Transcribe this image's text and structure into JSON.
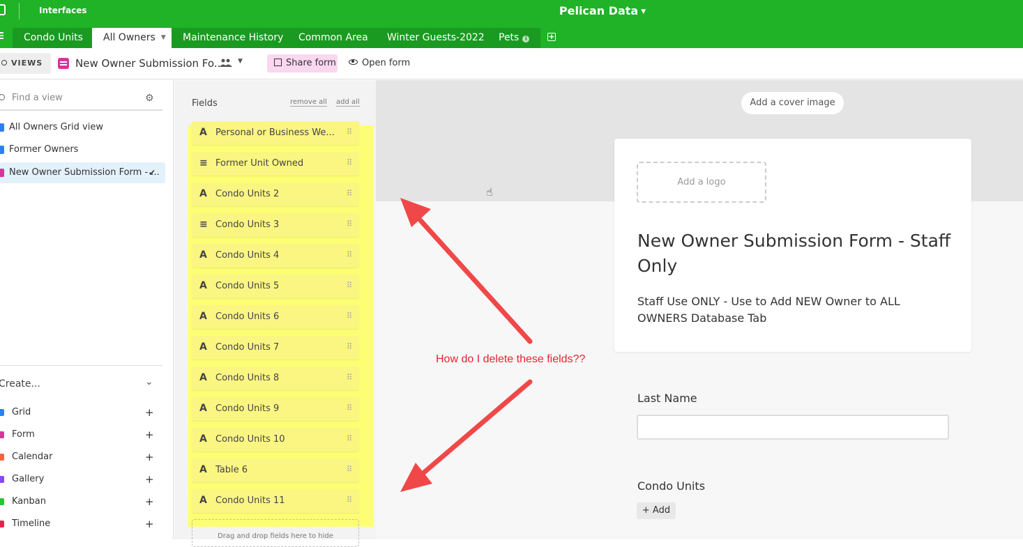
{
  "topbar": {
    "interfaces_label": "Interfaces",
    "base_title": "Pelican Data",
    "tabs": [
      "Condo Units",
      "All Owners",
      "Maintenance History",
      "Common Area",
      "Winter Guests-2022",
      "Pets"
    ],
    "active_tab": "All Owners"
  },
  "toolbar": {
    "views_label": "VIEWS",
    "view_name": "New Owner Submission Fo...",
    "share_label": "Share form",
    "open_label": "Open form"
  },
  "sidebar": {
    "find_placeholder": "Find a view",
    "views": [
      {
        "label": "All Owners Grid view",
        "color": "#2d7ff9"
      },
      {
        "label": "Former Owners",
        "color": "#2d7ff9"
      },
      {
        "label": "New Owner Submission Form - ...",
        "color": "#d6359c"
      }
    ],
    "create_label": "Create...",
    "create_items": [
      {
        "label": "Grid",
        "color": "#2d7ff9"
      },
      {
        "label": "Form",
        "color": "#d6359c"
      },
      {
        "label": "Calendar",
        "color": "#f7653b"
      },
      {
        "label": "Gallery",
        "color": "#8b46ff"
      },
      {
        "label": "Kanban",
        "color": "#20c933"
      },
      {
        "label": "Timeline",
        "color": "#e8234a"
      }
    ]
  },
  "fields_panel": {
    "title": "Fields",
    "remove_all": "remove all",
    "add_all": "add all",
    "fields": [
      {
        "type": "A",
        "name": "Personal or Business We..."
      },
      {
        "type": "≡",
        "name": "Former Unit Owned"
      },
      {
        "type": "A",
        "name": "Condo Units 2"
      },
      {
        "type": "≡",
        "name": "Condo Units 3"
      },
      {
        "type": "A",
        "name": "Condo Units 4"
      },
      {
        "type": "A",
        "name": "Condo Units 5"
      },
      {
        "type": "A",
        "name": "Condo Units 6"
      },
      {
        "type": "A",
        "name": "Condo Units 7"
      },
      {
        "type": "A",
        "name": "Condo Units 8"
      },
      {
        "type": "A",
        "name": "Condo Units 9"
      },
      {
        "type": "A",
        "name": "Condo Units 10"
      },
      {
        "type": "A",
        "name": "Table 6"
      },
      {
        "type": "A",
        "name": "Condo Units 11"
      }
    ],
    "drop_zone": "Drag and drop fields here to hide"
  },
  "form": {
    "cover_button": "Add a cover image",
    "logo_placeholder": "Add a logo",
    "title": "New Owner Submission Form - Staff Only",
    "description": "Staff Use ONLY - Use to Add NEW Owner to ALL OWNERS Database Tab",
    "field1_label": "Last Name",
    "field2_label": "Condo Units",
    "add_button": "+ Add"
  },
  "annotation_text": "How do I delete these fields??"
}
